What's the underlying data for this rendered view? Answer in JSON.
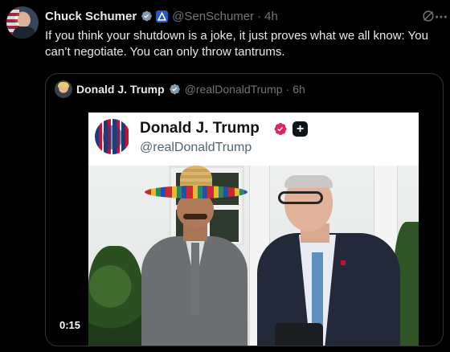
{
  "tweet": {
    "author_name": "Chuck Schumer",
    "handle": "@SenSchumer",
    "separator": "·",
    "time": "4h",
    "text": "If you think your shutdown is a joke, it just proves what we all know: You can’t negotiate. You can only throw tantrums."
  },
  "quoted_tweet": {
    "author_name": "Donald J. Trump",
    "handle": "@realDonaldTrump",
    "separator": "·",
    "time": "6h",
    "media": {
      "card_name": "Donald J. Trump",
      "card_handle": "@realDonaldTrump",
      "card_plus": "+",
      "video_duration": "0:15"
    }
  },
  "colors": {
    "background": "#000000",
    "text_primary": "#e7e9ea",
    "text_secondary": "#71767b",
    "verified_blue": "#1d9bf0",
    "card_check_pink": "#e0245e"
  },
  "icons": [
    "verified-badge-icon",
    "affiliate-badge-icon",
    "grok-icon",
    "more-icon",
    "card-verified-icon",
    "card-plus-icon"
  ]
}
